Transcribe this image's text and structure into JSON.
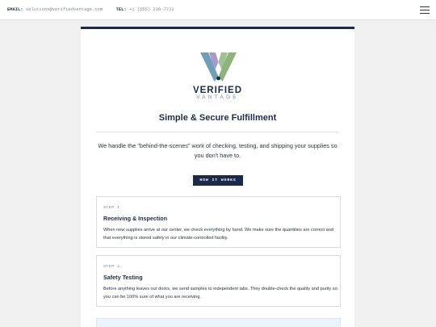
{
  "topbar": {
    "email_label": "EMAIL:",
    "email_value": "solutions@verifiedvantage.com",
    "tel_label": "TEL:",
    "tel_value": "+1 (555) 230-7722",
    "menu_icon": "hamburger-menu-icon"
  },
  "brand": {
    "line1": "VERIFIED",
    "line2": "VANTAGE",
    "logo_colors": [
      "#6e9fb8",
      "#8fb37a",
      "#a89bc9"
    ]
  },
  "hero": {
    "title": "Simple & Secure Fulfillment",
    "intro": "We handle the \"behind-the-scenes\" work of checking, testing, and shipping your supplies so you don't have to.",
    "button_label": "HOW IT WORKS"
  },
  "steps": [
    {
      "label": "STEP 1",
      "title": "Receiving & Inspection",
      "text": "When new supplies arrive at our center, we check everything by hand. We make sure the quantities are correct and that everything is stored safely in our climate-controlled facility."
    },
    {
      "label": "STEP 2",
      "title": "Safety Testing",
      "text": "Before anything leaves our doors, we send samples to independent labs. They double-check the quality and purity so you can be 100% sure of what you are receiving."
    }
  ],
  "colors": {
    "navy": "#1c2a4a",
    "accent_blue": "#6b84aa",
    "panel_bg": "#eaf4fb"
  }
}
